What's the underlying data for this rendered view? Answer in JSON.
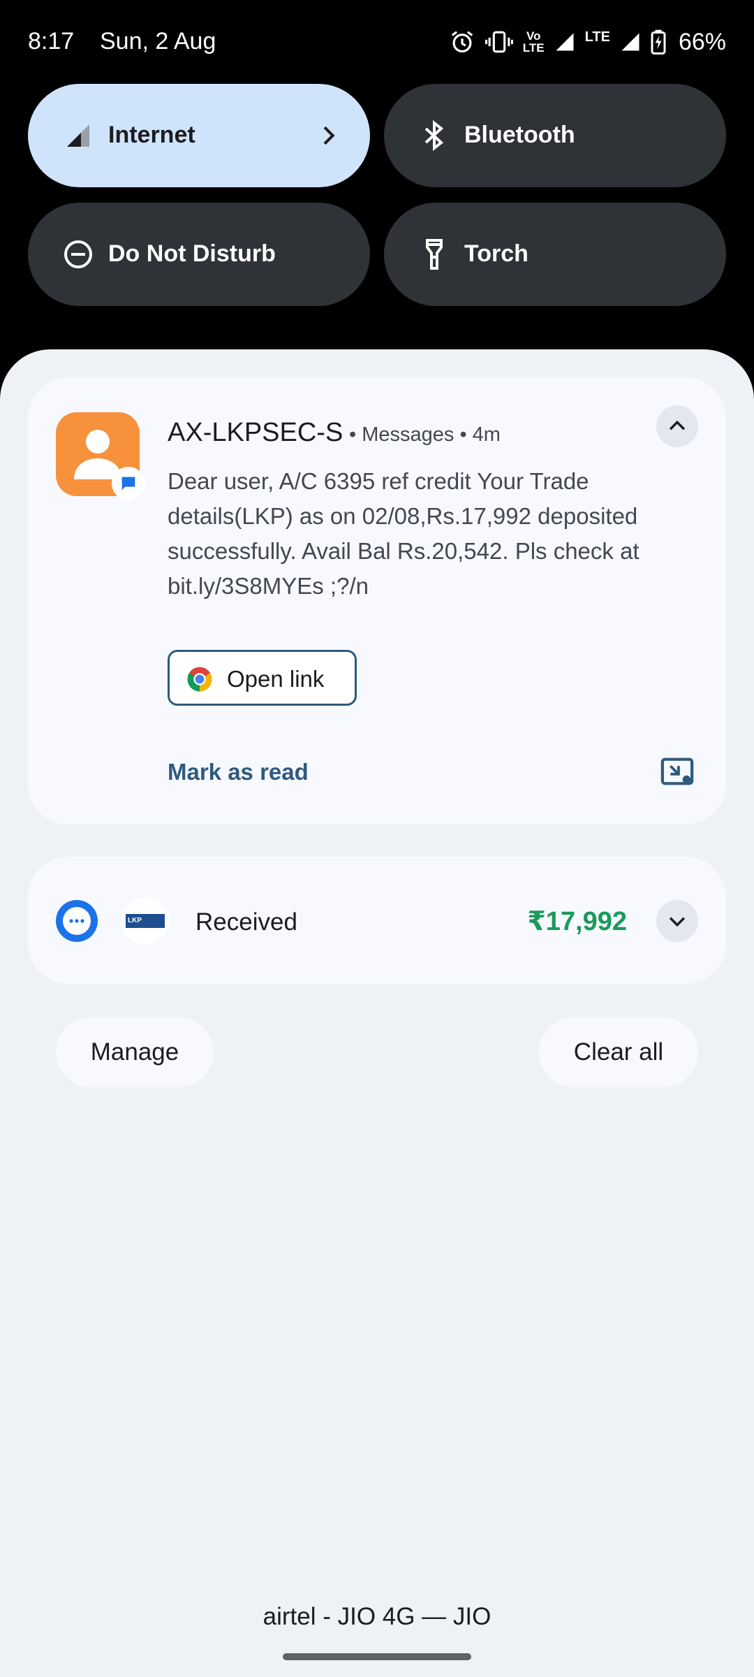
{
  "status_bar": {
    "time": "8:17",
    "date": "Sun, 2 Aug",
    "volte_top": "Vo",
    "volte_bottom": "LTE",
    "lte_label": "LTE",
    "battery": "66%",
    "icons": [
      "alarm-icon",
      "vibrate-icon",
      "volte-icon",
      "signal-icon",
      "lte-icon",
      "signal-icon",
      "battery-charging-icon"
    ]
  },
  "quick_tiles": [
    {
      "label": "Internet",
      "icon": "signal-icon",
      "active": true
    },
    {
      "label": "Bluetooth",
      "icon": "bluetooth-icon",
      "active": false
    },
    {
      "label": "Do Not Disturb",
      "icon": "do-not-disturb-icon",
      "active": false
    },
    {
      "label": "Torch",
      "icon": "flashlight-icon",
      "active": false
    }
  ],
  "notification": {
    "sender": "AX-LKPSEC-S",
    "meta": "• Messages • 4m",
    "body": "Dear user, A/C 6395 ref credit Your Trade details(LKP) as on 02/08,Rs.17,992 deposited successfully. Avail Bal Rs.20,542. Pls check at bit.ly/3S8MYEs ;?/n",
    "open_link_label": "Open link",
    "mark_read_label": "Mark as read"
  },
  "received_card": {
    "logo_text": "LKP",
    "label": "Received",
    "amount": "₹17,992"
  },
  "actions": {
    "manage_label": "Manage",
    "clear_label": "Clear all"
  },
  "footer": {
    "carrier": "airtel - JIO 4G — JIO"
  },
  "colors": {
    "tile_active": "#cfe3fb",
    "tile_dark": "#2f3237",
    "avatar": "#f8913c",
    "link_blue": "#2f5a7e",
    "amount_green": "#1a9a5b"
  }
}
